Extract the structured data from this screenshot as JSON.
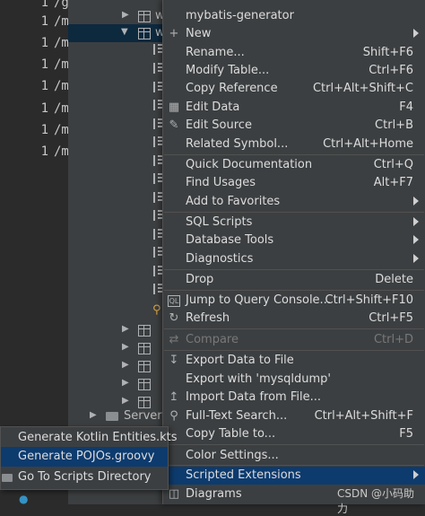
{
  "editor": {
    "gutter_rows": [
      {
        "num": "1",
        "text": "/g"
      },
      {
        "num": "1",
        "text": "/m"
      },
      {
        "num": "1",
        "text": "/m"
      },
      {
        "num": "1",
        "text": "/m"
      },
      {
        "num": "1",
        "text": "/m"
      },
      {
        "num": "1",
        "text": "/m"
      },
      {
        "num": "1",
        "text": "/m"
      },
      {
        "num": "1",
        "text": "/m"
      }
    ]
  },
  "tree": {
    "table_label": "w",
    "selected_label": "w",
    "server_label": "Server C"
  },
  "context_menu": {
    "header": "mybatis-generator",
    "items": [
      {
        "label": "New",
        "shortcut": "",
        "icon": "plus-icon"
      },
      {
        "label": "Rename...",
        "shortcut": "Shift+F6"
      },
      {
        "label": "Modify Table...",
        "shortcut": "Ctrl+F6"
      },
      {
        "label": "Copy Reference",
        "shortcut": "Ctrl+Alt+Shift+C"
      },
      {
        "label": "Edit Data",
        "shortcut": "F4",
        "icon": "grid-icon"
      },
      {
        "label": "Edit Source",
        "shortcut": "Ctrl+B",
        "icon": "pencil-icon"
      },
      {
        "label": "Related Symbol...",
        "shortcut": "Ctrl+Alt+Home"
      },
      {
        "label": "Quick Documentation",
        "shortcut": "Ctrl+Q"
      },
      {
        "label": "Find Usages",
        "shortcut": "Alt+F7"
      },
      {
        "label": "Add to Favorites",
        "shortcut": ""
      },
      {
        "label": "SQL Scripts",
        "shortcut": ""
      },
      {
        "label": "Database Tools",
        "shortcut": ""
      },
      {
        "label": "Diagnostics",
        "shortcut": ""
      },
      {
        "label": "Drop",
        "shortcut": "Delete"
      },
      {
        "label": "Jump to Query Console...",
        "shortcut": "Ctrl+Shift+F10",
        "icon": "ql-icon"
      },
      {
        "label": "Refresh",
        "shortcut": "Ctrl+F5",
        "icon": "refresh-icon"
      },
      {
        "label": "Compare",
        "shortcut": "Ctrl+D",
        "icon": "compare-icon"
      },
      {
        "label": "Export Data to File",
        "shortcut": "",
        "icon": "export-icon"
      },
      {
        "label": "Export with 'mysqldump'",
        "shortcut": ""
      },
      {
        "label": "Import Data from File...",
        "shortcut": "",
        "icon": "import-icon"
      },
      {
        "label": "Full-Text Search...",
        "shortcut": "Ctrl+Alt+Shift+F",
        "icon": "search-icon"
      },
      {
        "label": "Copy Table to...",
        "shortcut": "F5"
      },
      {
        "label": "Color Settings...",
        "shortcut": ""
      },
      {
        "label": "Scripted Extensions",
        "shortcut": ""
      },
      {
        "label": "Diagrams",
        "shortcut": "",
        "icon": "diagram-icon"
      }
    ]
  },
  "submenu": {
    "items": [
      {
        "label": "Generate Kotlin Entities.kts"
      },
      {
        "label": "Generate POJOs.groovy"
      },
      {
        "label": "Go To Scripts Directory"
      }
    ]
  },
  "watermark": "CSDN @小码助力",
  "colors": {
    "menu_bg": "#3c3f41",
    "highlight": "#0d3b6e",
    "tree_selected": "#0d293e"
  }
}
